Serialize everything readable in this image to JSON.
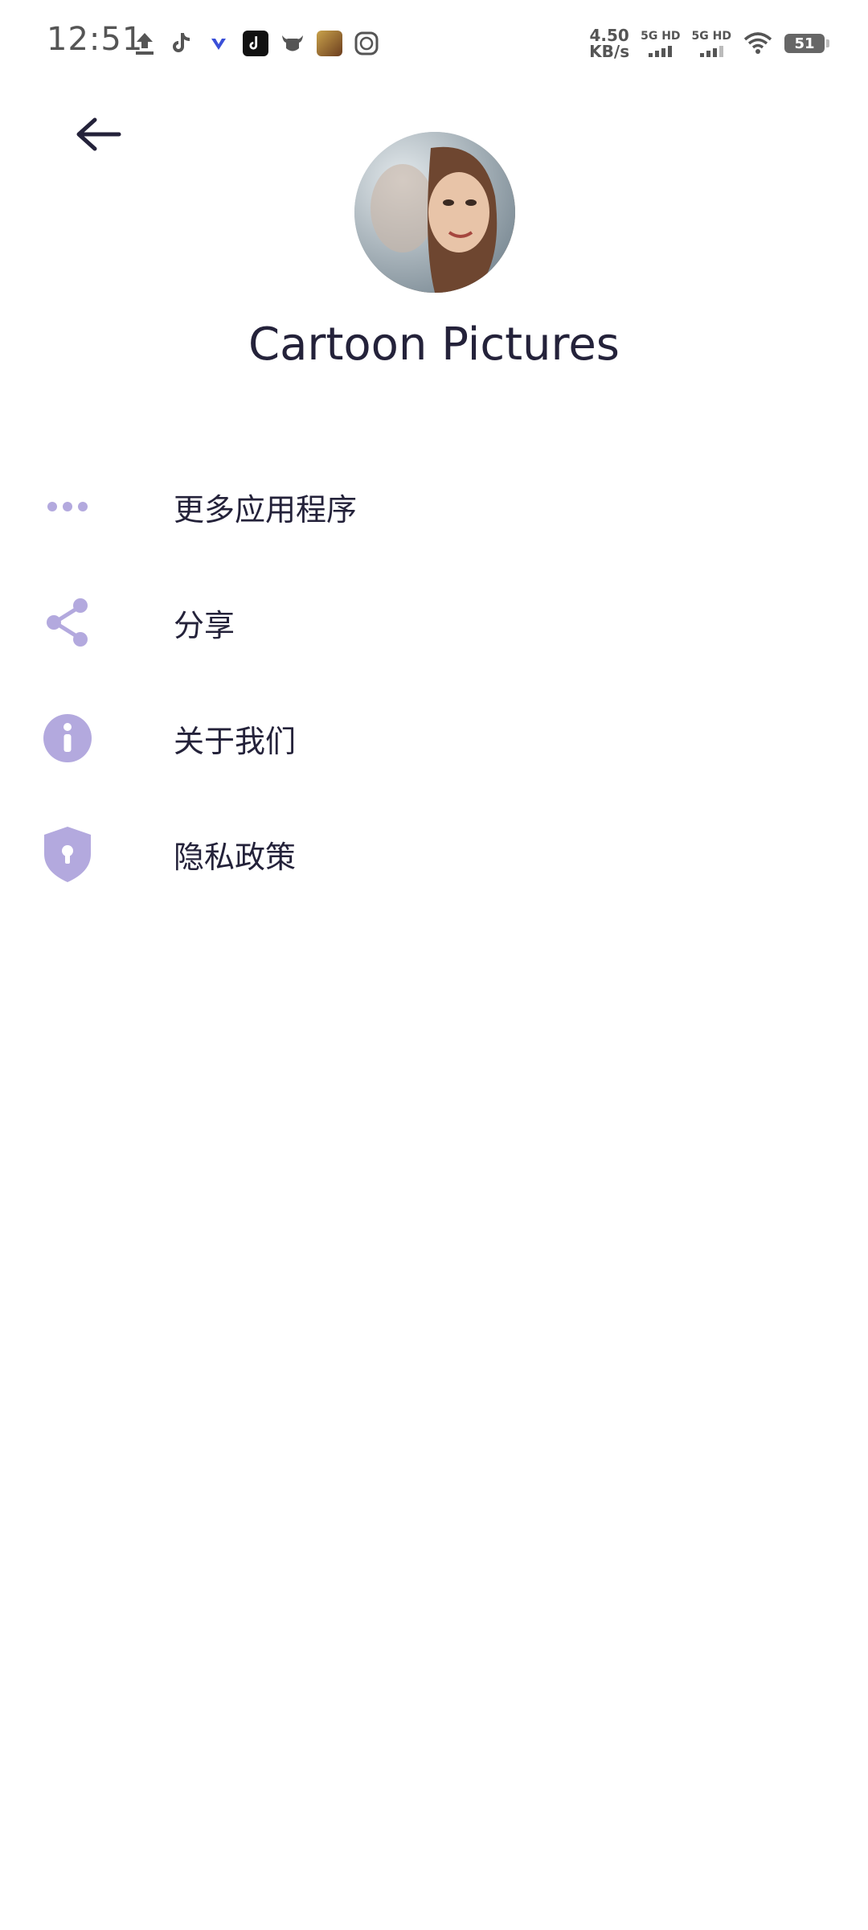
{
  "status_bar": {
    "time": "12:51",
    "speed_value": "4.50",
    "speed_unit": "KB/s",
    "sim1_label": "5G HD",
    "sim2_label": "5G HD",
    "battery": "51"
  },
  "header": {
    "app_title": "Cartoon Pictures"
  },
  "menu": {
    "items": [
      {
        "label": "更多应用程序",
        "icon": "more-dots-icon"
      },
      {
        "label": "分享",
        "icon": "share-icon"
      },
      {
        "label": "关于我们",
        "icon": "info-icon"
      },
      {
        "label": "隐私政策",
        "icon": "shield-lock-icon"
      }
    ]
  },
  "colors": {
    "accent": "#b3a9de",
    "text": "#24223a",
    "background": "#ffffff"
  }
}
